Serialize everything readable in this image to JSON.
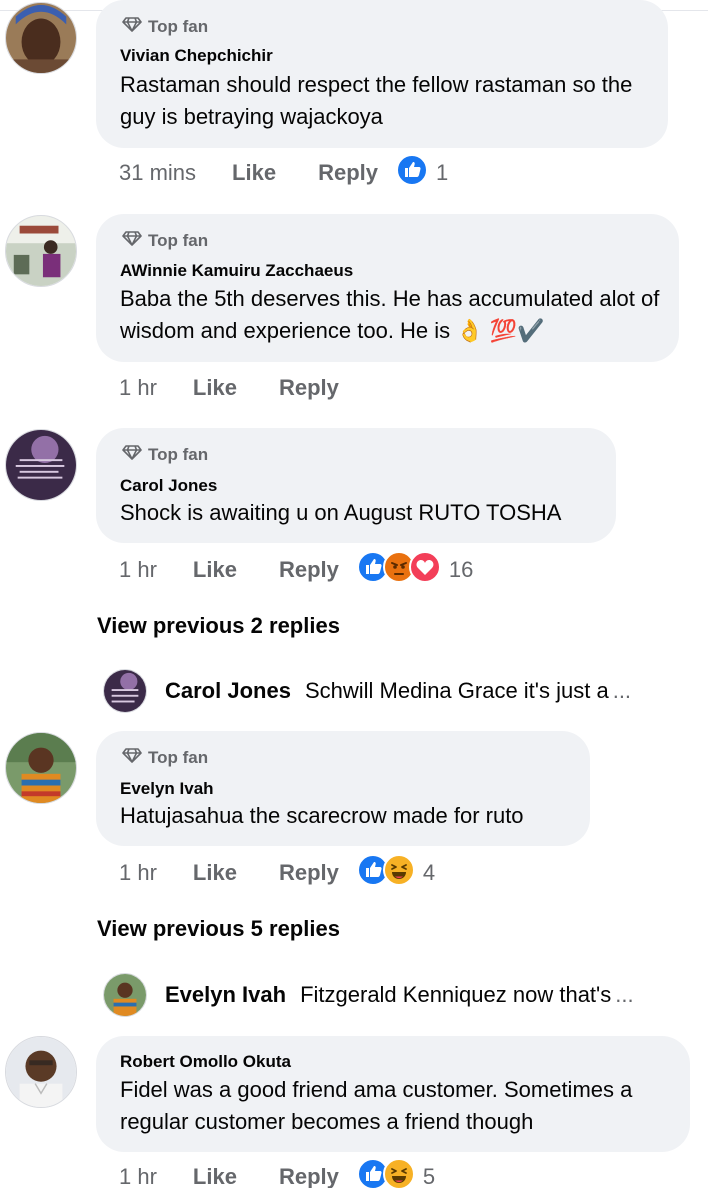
{
  "comments": [
    {
      "badge": "Top fan",
      "author": "Vivian Chepchichir",
      "text": "Rastaman should respect the fellow rastaman so the guy is betraying wajackoya",
      "time": "31 mins",
      "like": "Like",
      "reply": "Reply",
      "reactions": [
        "like"
      ],
      "reaction_count": "1"
    },
    {
      "badge": "Top fan",
      "author": "AWinnie Kamuiru Zacchaeus",
      "text": "Baba the 5th deserves this. He has accumulated alot of wisdom and experience too. He is 👌 💯✔️",
      "time": "1 hr",
      "like": "Like",
      "reply": "Reply"
    },
    {
      "badge": "Top fan",
      "author": "Carol Jones",
      "text": "Shock is awaiting u on August RUTO TOSHA",
      "time": "1 hr",
      "like": "Like",
      "reply": "Reply",
      "reactions": [
        "like",
        "angry",
        "love"
      ],
      "reaction_count": "16",
      "view_previous": "View previous 2 replies",
      "reply_preview": {
        "author": "Carol Jones",
        "text": "Schwill Medina Grace it's just a",
        "more": "..."
      }
    },
    {
      "badge": "Top fan",
      "author": "Evelyn Ivah",
      "text": "Hatujasahua the scarecrow made for ruto",
      "time": "1 hr",
      "like": "Like",
      "reply": "Reply",
      "reactions": [
        "like",
        "haha"
      ],
      "reaction_count": "4",
      "view_previous": "View previous 5 replies",
      "reply_preview": {
        "author": "Evelyn Ivah",
        "text": "Fitzgerald Kenniquez now that's",
        "more": "..."
      }
    },
    {
      "author": "Robert Omollo Okuta",
      "text": "Fidel was a good friend ama customer. Sometimes a regular customer becomes a friend though",
      "time": "1 hr",
      "like": "Like",
      "reply": "Reply",
      "reactions": [
        "like",
        "haha"
      ],
      "reaction_count": "5"
    }
  ],
  "colors": {
    "bubble_bg": "#f0f2f5",
    "secondary_text": "#65676b",
    "primary_text": "#050505",
    "like_blue": "#1877f2",
    "love_red": "#f33e58",
    "angry_orange": "#e9710f",
    "haha_yellow": "#f7b125"
  }
}
